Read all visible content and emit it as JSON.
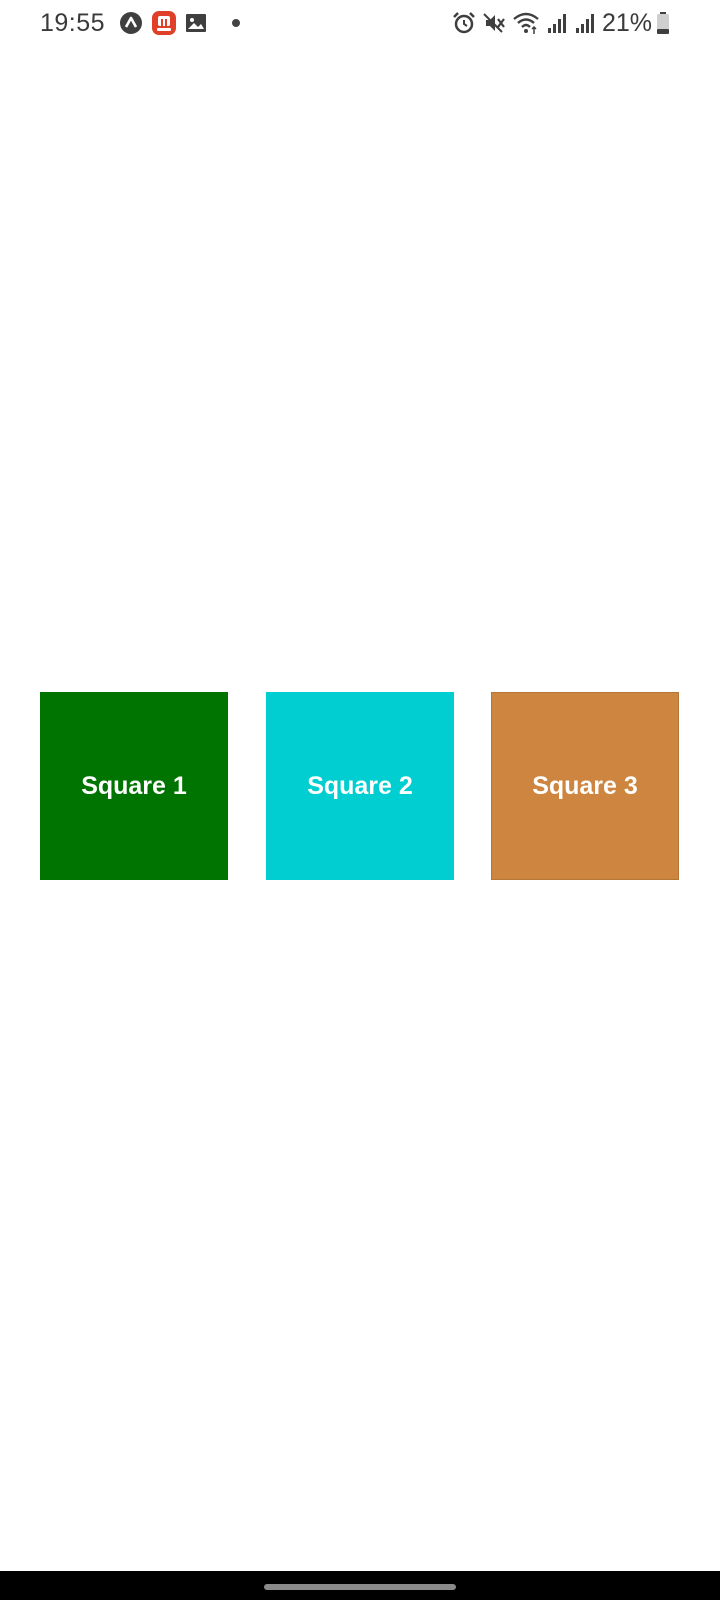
{
  "status_bar": {
    "time": "19:55",
    "notification_icons": [
      "app-a-icon",
      "app-red-icon",
      "gallery-icon",
      "dot-icon"
    ],
    "system_icons": [
      "alarm-icon",
      "mute-icon",
      "wifi-icon",
      "signal-icon",
      "signal-icon"
    ],
    "battery_percent": "21%"
  },
  "squares": [
    {
      "label": "Square 1",
      "color": "#007400"
    },
    {
      "label": "Square 2",
      "color": "#00CED1"
    },
    {
      "label": "Square 3",
      "color": "#CD853F"
    }
  ],
  "nav_bar": {
    "color": "#000000"
  }
}
